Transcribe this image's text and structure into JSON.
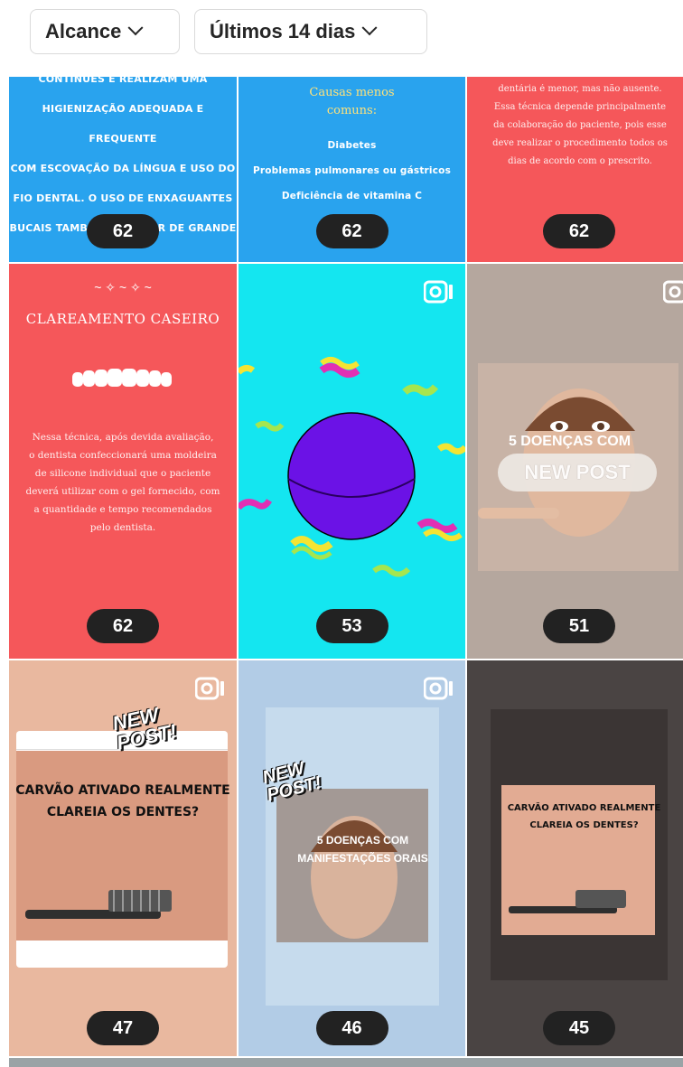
{
  "filters": {
    "metric": "Alcance",
    "period": "Últimos 14 dias"
  },
  "posts": [
    {
      "count": "62",
      "lines": [
        "CONTINUES E REALIZAM UMA",
        "HIGIENIZAÇÃO ADEQUADA E FREQUENTE",
        "COM ESCOVAÇÃO DA LÍNGUA E USO DO",
        "FIO DENTAL. O USO DE ENXAGUANTES",
        "BUCAIS TAMBÉM PODE SER DE GRANDE"
      ]
    },
    {
      "count": "62",
      "heading": "Causas menos comuns:",
      "lines": [
        "Diabetes",
        "Problemas pulmonares ou gástricos",
        "Deficiência de vitamina C"
      ]
    },
    {
      "count": "62",
      "lines": [
        "dentária é menor, mas não ausente.",
        "Essa técnica depende principalmente",
        "da colaboração do paciente, pois esse",
        "deve realizar o procedimento todos os",
        "dias de acordo com o prescrito."
      ]
    },
    {
      "count": "62",
      "heading": "CLAREAMENTO CASEIRO",
      "lines": [
        "Nessa técnica, após devida avaliação,",
        "o dentista confeccionará uma moldeira",
        "de silicone individual que o paciente",
        "deverá utilizar com o gel fornecido, com",
        "a quantidade e tempo recomendados",
        "pelo dentista."
      ]
    },
    {
      "count": "53",
      "icon": "video-camera-icon"
    },
    {
      "count": "51",
      "icon": "video-camera-icon",
      "lines": [
        "5 DOENÇAS COM",
        "NEW POST"
      ]
    },
    {
      "count": "47",
      "icon": "video-camera-icon",
      "lines": [
        "NEW POST!",
        "CARVÃO ATIVADO REALMENTE",
        "CLAREIA OS DENTES?"
      ]
    },
    {
      "count": "46",
      "icon": "video-camera-icon",
      "lines": [
        "NEW POST!",
        "5 DOENÇAS COM",
        "MANIFESTAÇÕES ORAIS"
      ]
    },
    {
      "count": "45",
      "lines": [
        "CARVÃO ATIVADO REALMENTE",
        "CLAREIA OS DENTES?"
      ]
    }
  ]
}
